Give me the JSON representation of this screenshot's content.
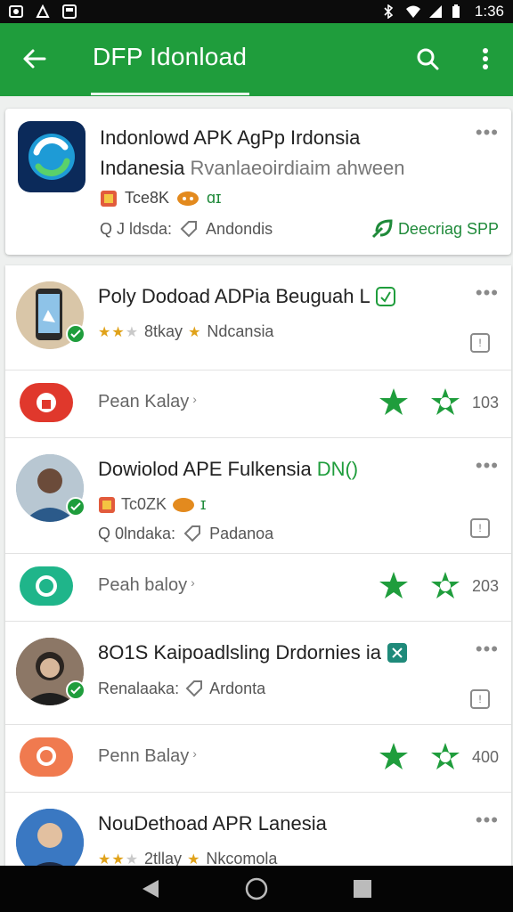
{
  "status_bar": {
    "time": "1:36"
  },
  "app_bar": {
    "title": "DFP Idonload"
  },
  "featured": {
    "title_line1": "Indonlowd APK AgPp Irdonsia",
    "title_line2": "Indanesia",
    "title_line2_sub": "Rvanlaeoirdiaim ahween",
    "tag1": "Tce8K",
    "tag2": "ɑɪ",
    "location_label": "Q J ldsda:",
    "location_value": "Andondis",
    "download_label": "Deecriag SPP"
  },
  "rows": [
    {
      "title": "Poly Dodoad ADPia Beuguah L",
      "rating_text": "8tkay",
      "country": "Ndcansia",
      "sub_label": "Pean Kalay",
      "sub_count": "103"
    },
    {
      "title": "Dowiolod APE Fulkensia",
      "title_badge": "DN()",
      "tag1": "Tc0ZK",
      "tag2": "ɪ",
      "location_label": "Q 0lndaka:",
      "location_value": "Padanoa",
      "sub_label": "Peah baloy",
      "sub_count": "203"
    },
    {
      "title": "8O1S Kaipoadlsling Drdornies ia",
      "location_label": "Renalaaka:",
      "location_value": "Ardonta",
      "sub_label": "Penn Balay",
      "sub_count": "400"
    },
    {
      "title": "NouDethoad APR Lanesia",
      "rating_text": "2tllay",
      "country": "Nkcomola"
    }
  ],
  "colors": {
    "primary": "#1f9d3c",
    "accent_star": "#e0a21a"
  }
}
